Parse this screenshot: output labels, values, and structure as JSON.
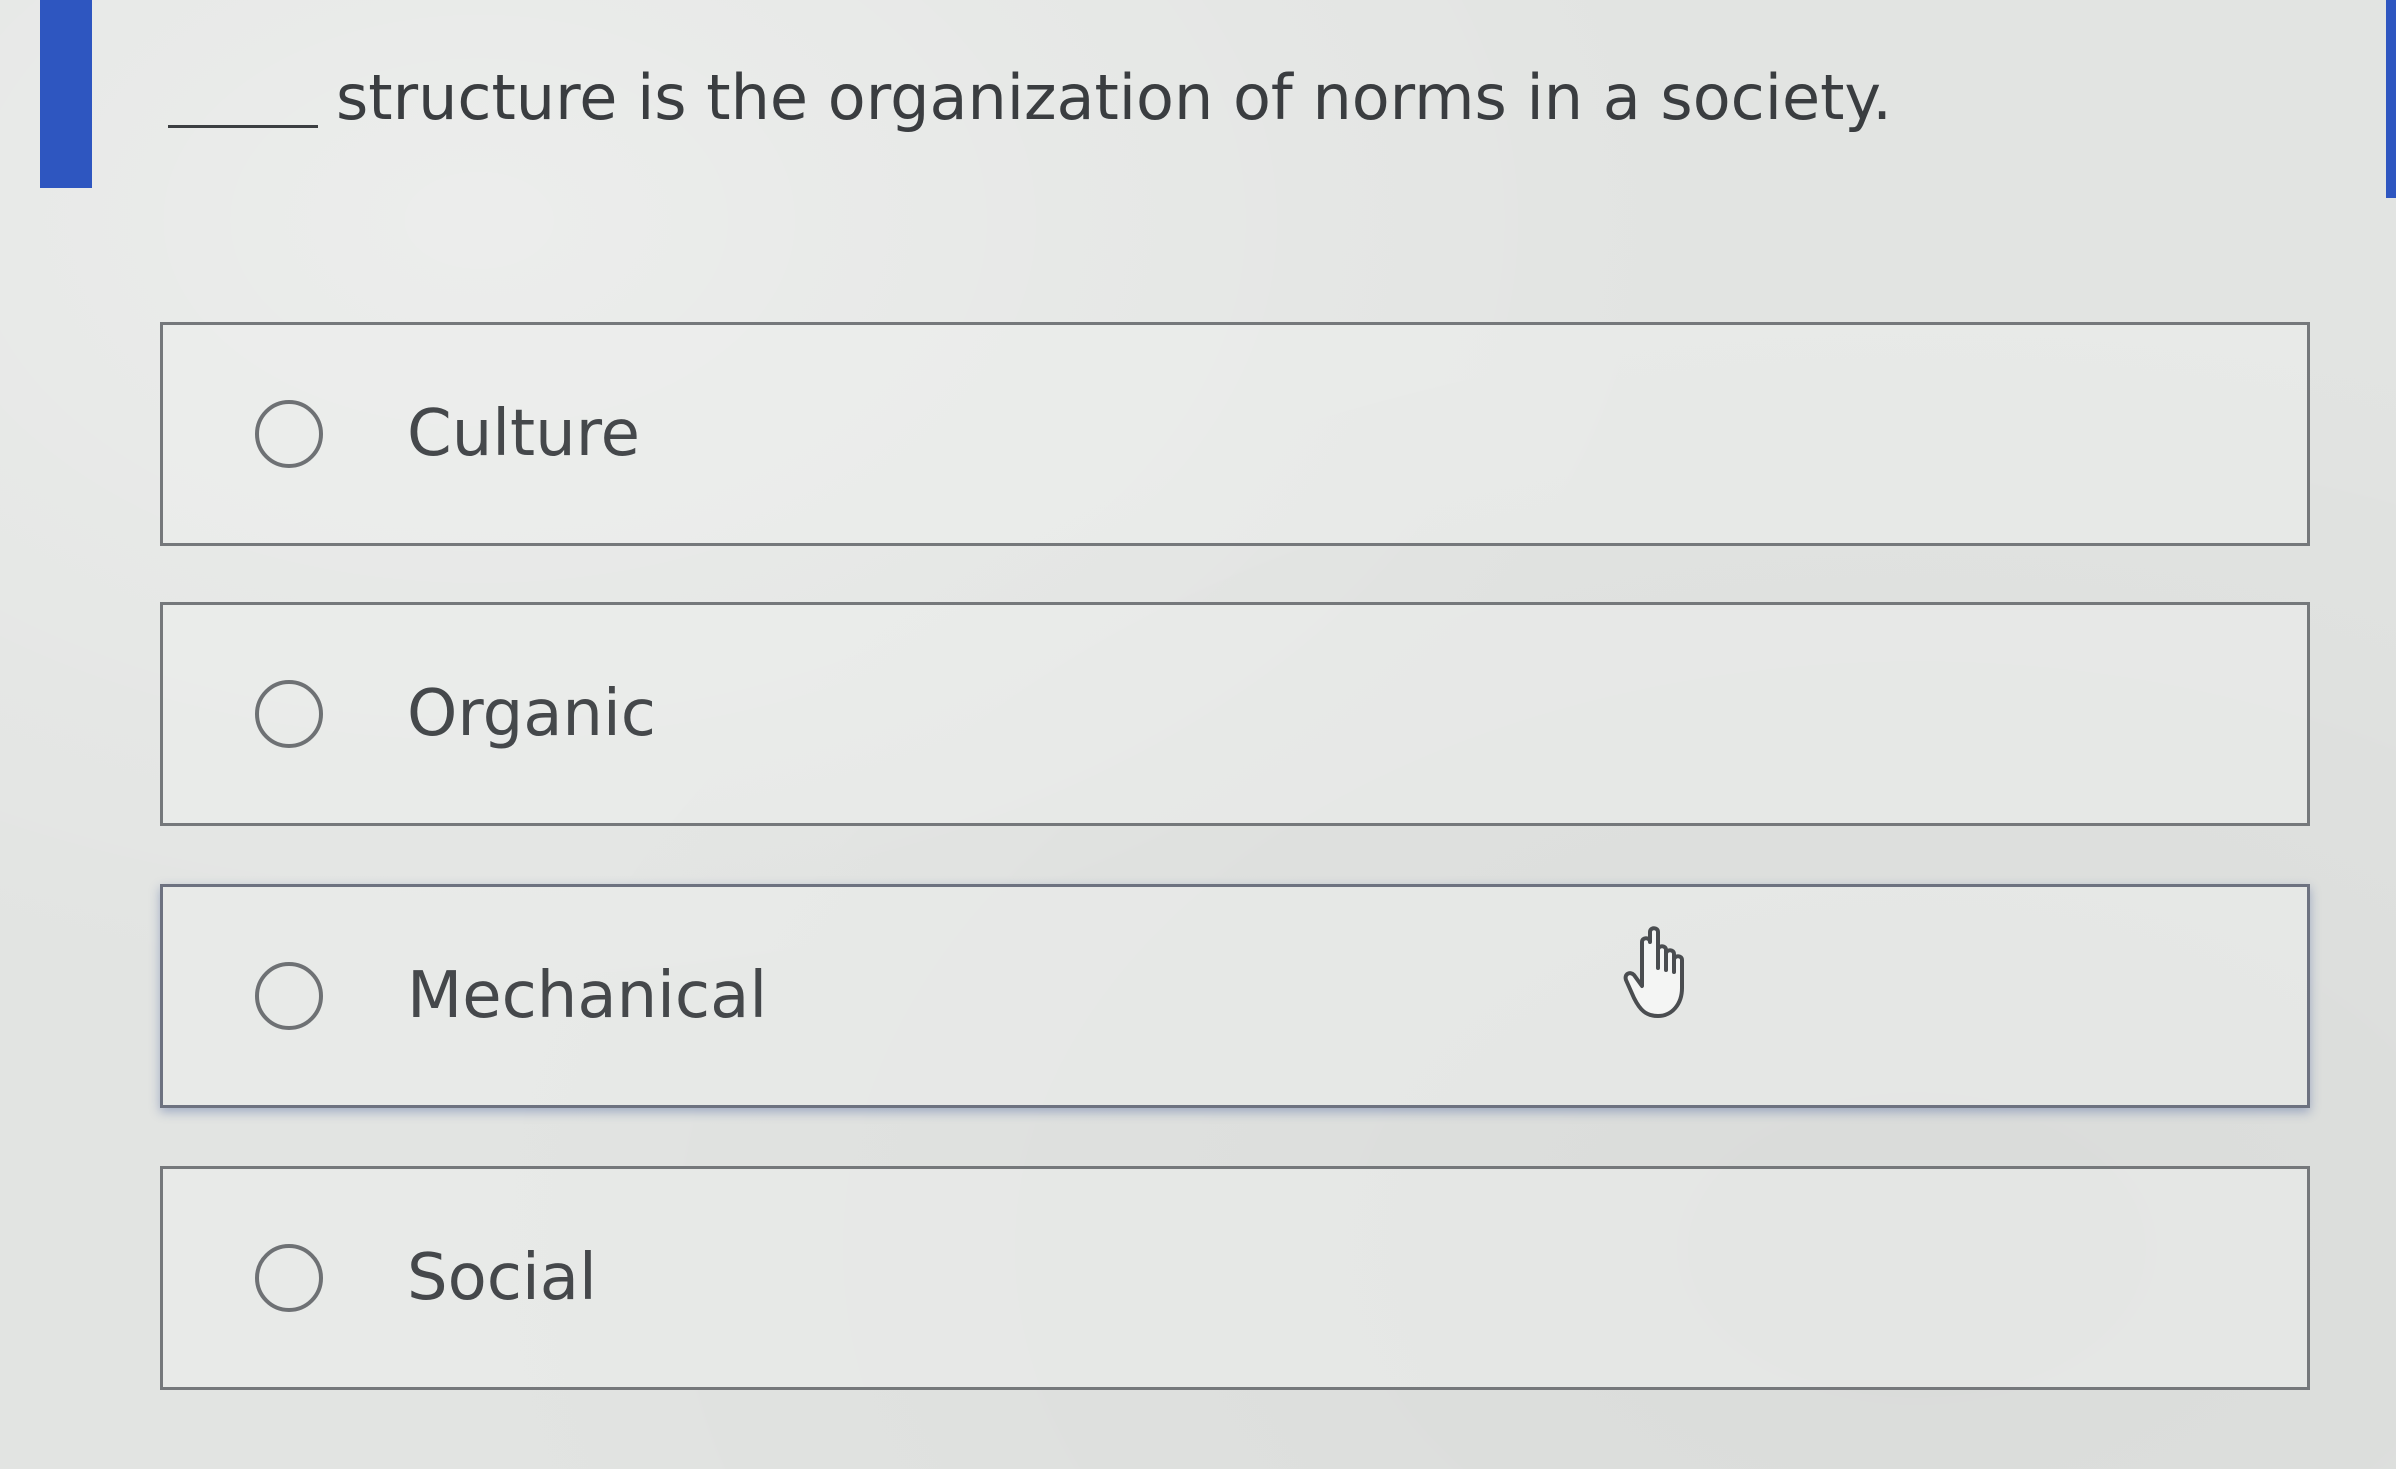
{
  "question": {
    "text": "structure is the organization of norms in a society."
  },
  "options": [
    {
      "label": "Culture",
      "selected": false
    },
    {
      "label": "Organic",
      "selected": false
    },
    {
      "label": "Mechanical",
      "selected": false
    },
    {
      "label": "Social",
      "selected": false
    }
  ],
  "colors": {
    "accent": "#2e56c0",
    "background": "#e2e4e2",
    "border": "#75787b",
    "text": "#3a3d40"
  },
  "icons": {
    "cursor": "hand-pointer-icon",
    "option_marker": "radio-circle-icon"
  }
}
